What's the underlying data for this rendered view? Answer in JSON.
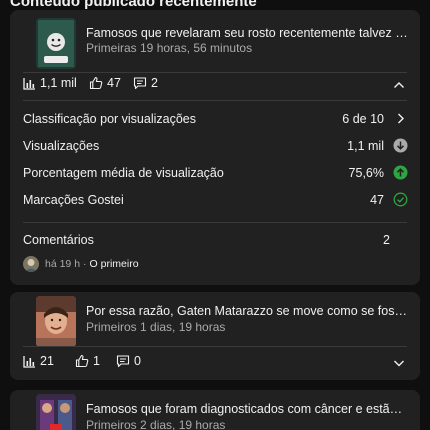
{
  "section": {
    "title": "Conteúdo publicado recentemente"
  },
  "cards": [
    {
      "title": "Famosos que revelaram seu rosto recentemente talvez você ...",
      "time": "Primeiras 19 horas, 56 minutos",
      "views": "1,1 mil",
      "likes": "47",
      "comments": "2",
      "metrics": {
        "rank_label": "Classificação por visualizações",
        "rank_value": "6 de 10",
        "views_label": "Visualizações",
        "views_value": "1,1 mil",
        "avg_label": "Porcentagem média de visualização",
        "avg_value": "75,6%",
        "likes_label": "Marcações Gostei",
        "likes_value": "47"
      },
      "comments_section": {
        "label": "Comentários",
        "count": "2",
        "time": "há 19 h",
        "sep": "·",
        "first": "O primeiro"
      }
    },
    {
      "title": "Por essa razão, Gaten Matarazzo se move como se fosse um...",
      "time": "Primeiros 1 dias, 19 horas",
      "views": "21",
      "likes": "1",
      "comments": "0"
    },
    {
      "title": "Famosos que foram diagnosticados com câncer e estão à be...",
      "time": "Primeiros 2 dias, 19 horas"
    }
  ],
  "colors": {
    "background": "#0f0f0f",
    "card": "#212121",
    "green": "#2ba640",
    "muted": "#aaaaaa"
  },
  "icons": [
    "bar-chart-icon",
    "thumbs-up-icon",
    "comment-icon",
    "chevron-up-icon",
    "chevron-down-icon",
    "chevron-right-icon",
    "arrow-down-circle-icon",
    "arrow-up-circle-icon",
    "check-circle-icon"
  ]
}
